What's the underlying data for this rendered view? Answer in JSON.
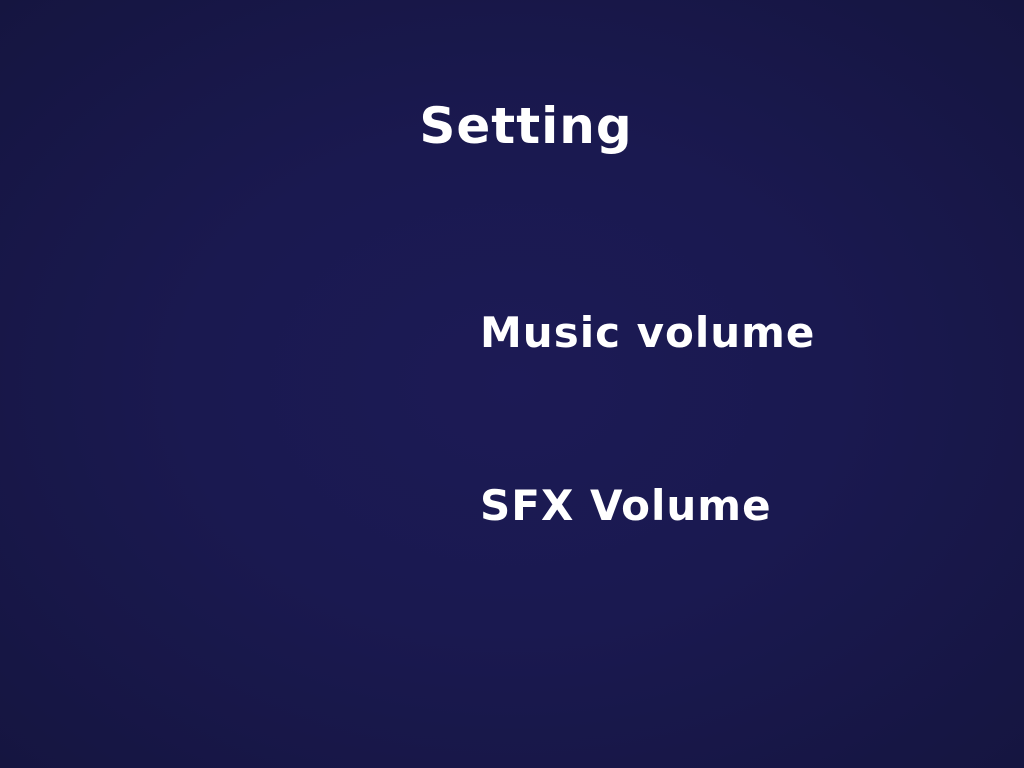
{
  "screen": {
    "title": "Setting"
  },
  "menu": {
    "items": [
      {
        "label": "Music volume"
      },
      {
        "label": "SFX Volume"
      }
    ]
  },
  "colors": {
    "background": "#1a1950",
    "text": "#ffffff"
  }
}
